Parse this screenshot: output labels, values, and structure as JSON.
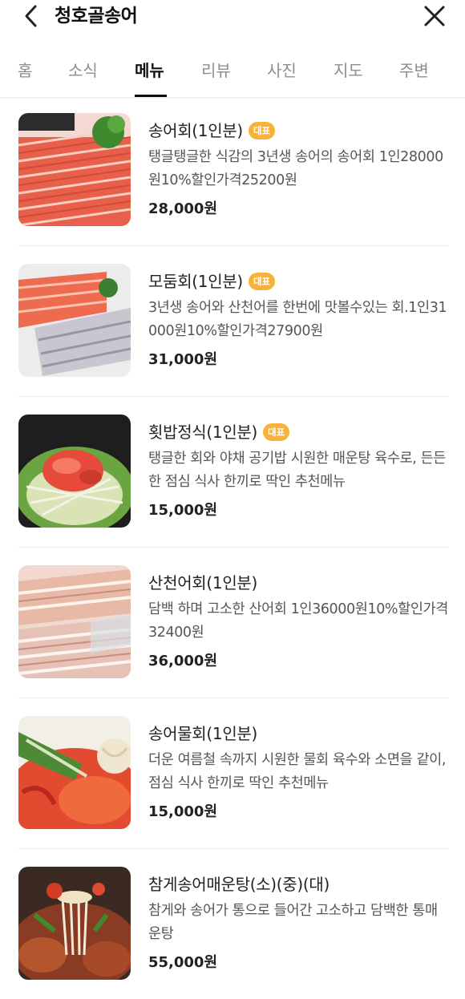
{
  "header": {
    "title": "청호골송어",
    "back_icon": "chevron-left-icon",
    "close_icon": "close-icon"
  },
  "tabs": [
    {
      "label": "홈",
      "active": false
    },
    {
      "label": "소식",
      "active": false
    },
    {
      "label": "메뉴",
      "active": true
    },
    {
      "label": "리뷰",
      "active": false
    },
    {
      "label": "사진",
      "active": false
    },
    {
      "label": "지도",
      "active": false
    },
    {
      "label": "주변",
      "active": false
    }
  ],
  "colors": {
    "badge": "#f7b23b",
    "active_tab": "#111111",
    "inactive_tab": "#8e8e8e"
  },
  "menu": {
    "items": [
      {
        "name": "송어회(1인분)",
        "badge": "대표",
        "desc": "탱글탱글한 식감의 3년생 송어의 송어회 1인28000원10%할인가격25200원",
        "price": "28,000원"
      },
      {
        "name": "모둠회(1인분)",
        "badge": "대표",
        "desc": "3년생 송어와 산천어를 한번에 맛볼수있는 회.1인31000원10%할인가격27900원",
        "price": "31,000원"
      },
      {
        "name": "횟밥정식(1인분)",
        "badge": "대표",
        "desc": "탱글한 회와 야채 공기밥 시원한 매운탕 육수로, 든든한 점심 식사 한끼로 딱인 추천메뉴",
        "price": "15,000원"
      },
      {
        "name": "산천어회(1인분)",
        "badge": "",
        "desc": "담백 하며 고소한 산어회 1인36000원10%할인가격32400원",
        "price": "36,000원"
      },
      {
        "name": "송어물회(1인분)",
        "badge": "",
        "desc": "더운 여름철 속까지 시원한 물회 육수와 소면을 같이, 점심 식사 한끼로 딱인 추천메뉴",
        "price": "15,000원"
      },
      {
        "name": "참게송어매운탕(소)(중)(대)",
        "badge": "",
        "desc": "참게와 송어가 통으로 들어간 고소하고 담백한 통매운탕",
        "price": "55,000원"
      }
    ]
  }
}
